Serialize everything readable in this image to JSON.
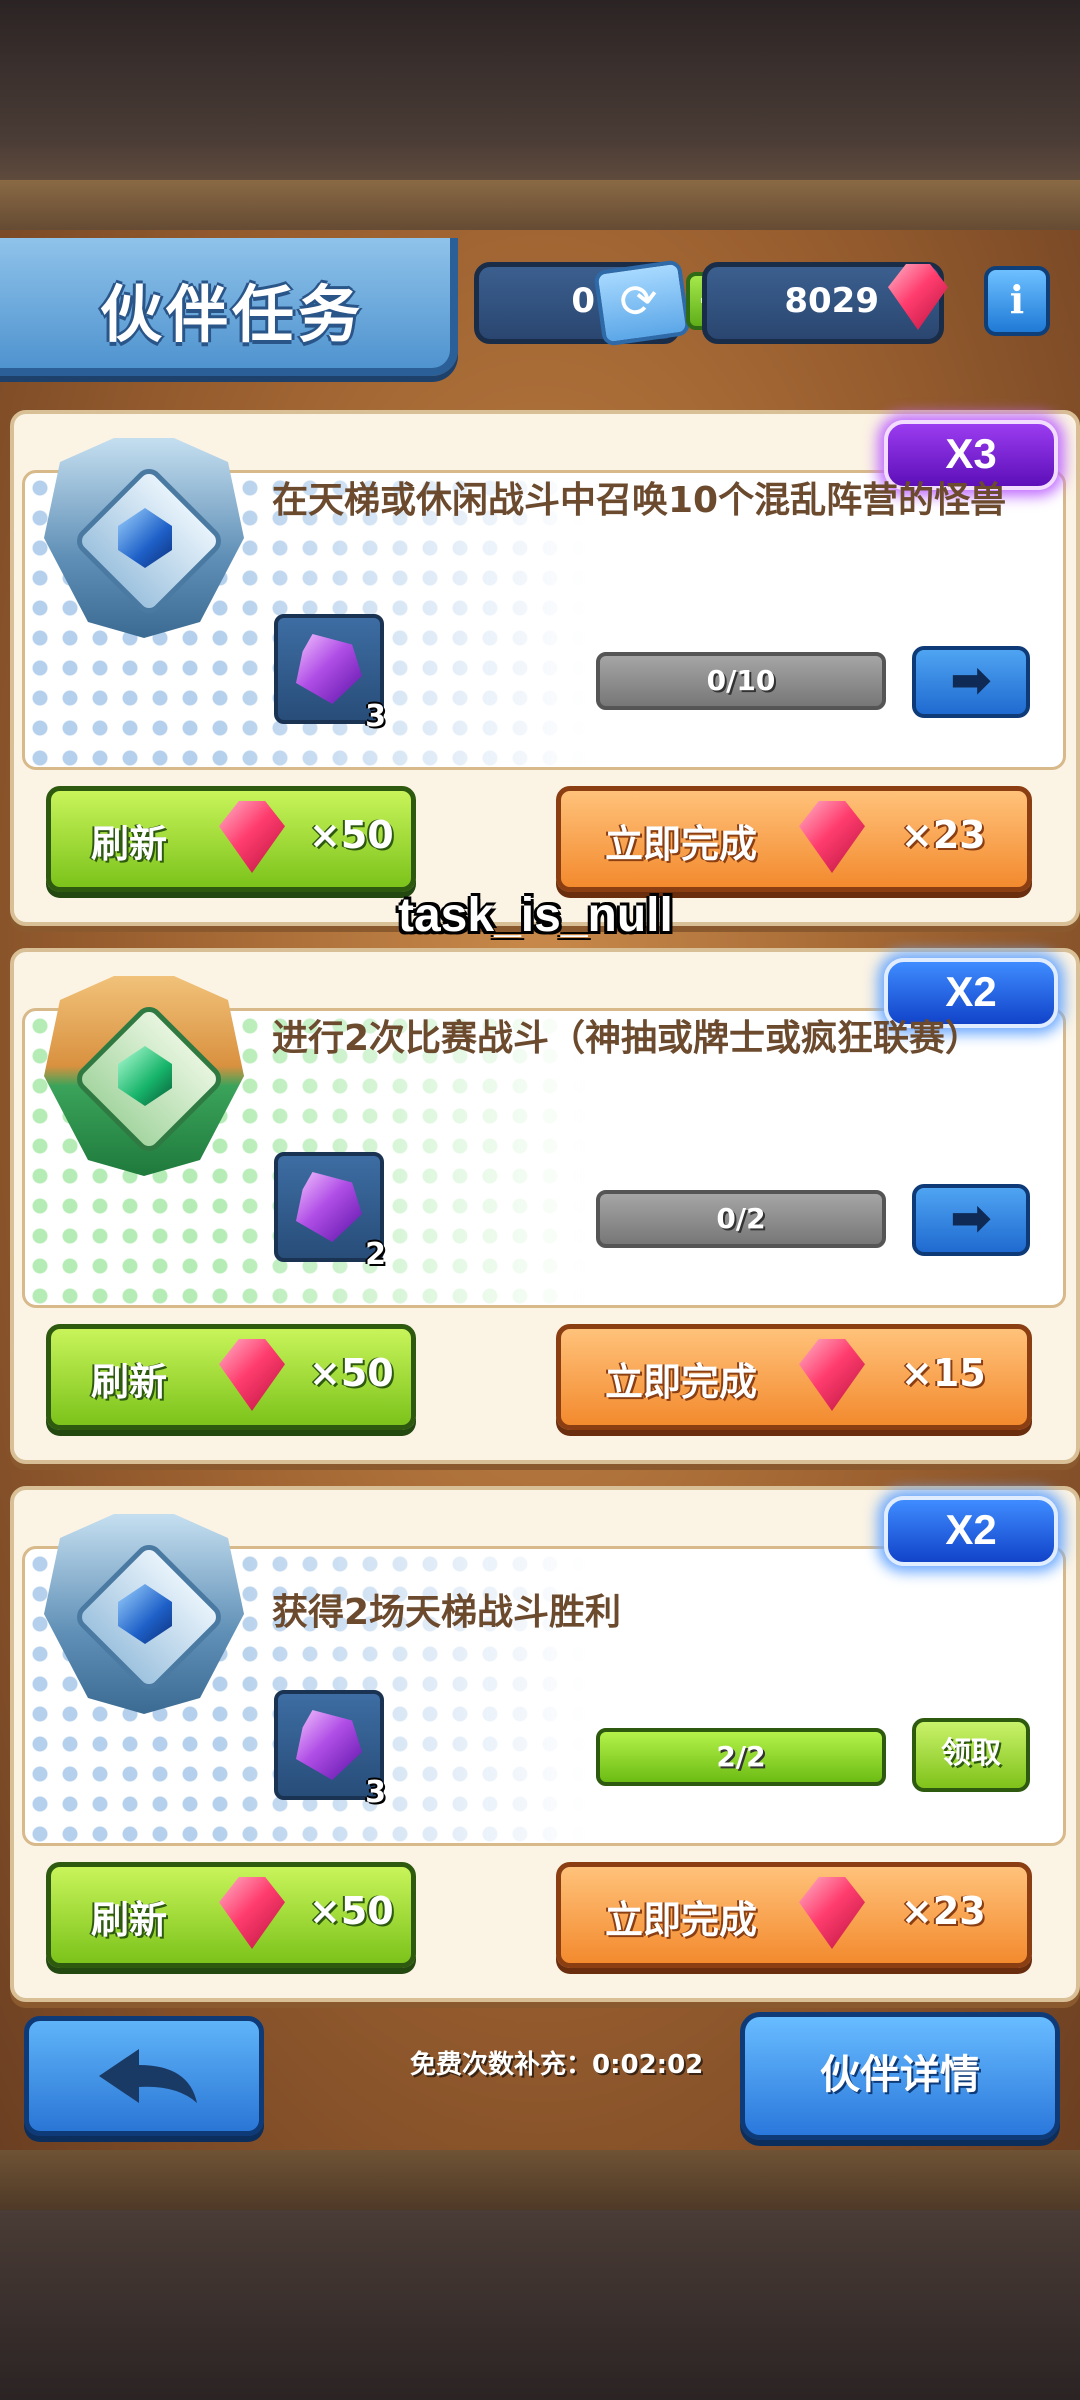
{
  "header": {
    "title": "伙伴任务",
    "tickets": "0",
    "gems": "8029",
    "plus_label": "+",
    "info_label": "i"
  },
  "tasks": [
    {
      "multiplier": "X3",
      "multiplier_color": "#7a1fd6",
      "description": "在天梯或休闲战斗中召唤10个混乱阵营的怪兽",
      "reward_count": "3",
      "progress": "0/10",
      "progress_fraction": 0.0,
      "action": "arrow",
      "refresh_label": "刷新",
      "refresh_cost": "×50",
      "complete_label": "立即完成",
      "complete_cost": "×23"
    },
    {
      "multiplier": "X2",
      "multiplier_color": "#1f5fe0",
      "description": "进行2次比赛战斗（神抽或牌士或疯狂联赛）",
      "reward_count": "2",
      "progress": "0/2",
      "progress_fraction": 0.0,
      "action": "arrow",
      "refresh_label": "刷新",
      "refresh_cost": "×50",
      "complete_label": "立即完成",
      "complete_cost": "×15"
    },
    {
      "multiplier": "X2",
      "multiplier_color": "#1f5fe0",
      "description": "获得2场天梯战斗胜利",
      "reward_count": "3",
      "progress": "2/2",
      "progress_fraction": 1.0,
      "action": "claim",
      "claim_label": "领取",
      "refresh_label": "刷新",
      "refresh_cost": "×50",
      "complete_label": "立即完成",
      "complete_cost": "×23"
    }
  ],
  "overlay_label": "task_is_null",
  "footer": {
    "timer_text": "免费次数补充：0:02:02",
    "detail_label": "伙伴详情"
  },
  "icons": {
    "gem": "red-gem-icon",
    "ticket": "refresh-ticket-icon",
    "reward": "purple-crystal-icon",
    "arrow": "arrow-right-icon",
    "back": "back-arrow-icon"
  }
}
